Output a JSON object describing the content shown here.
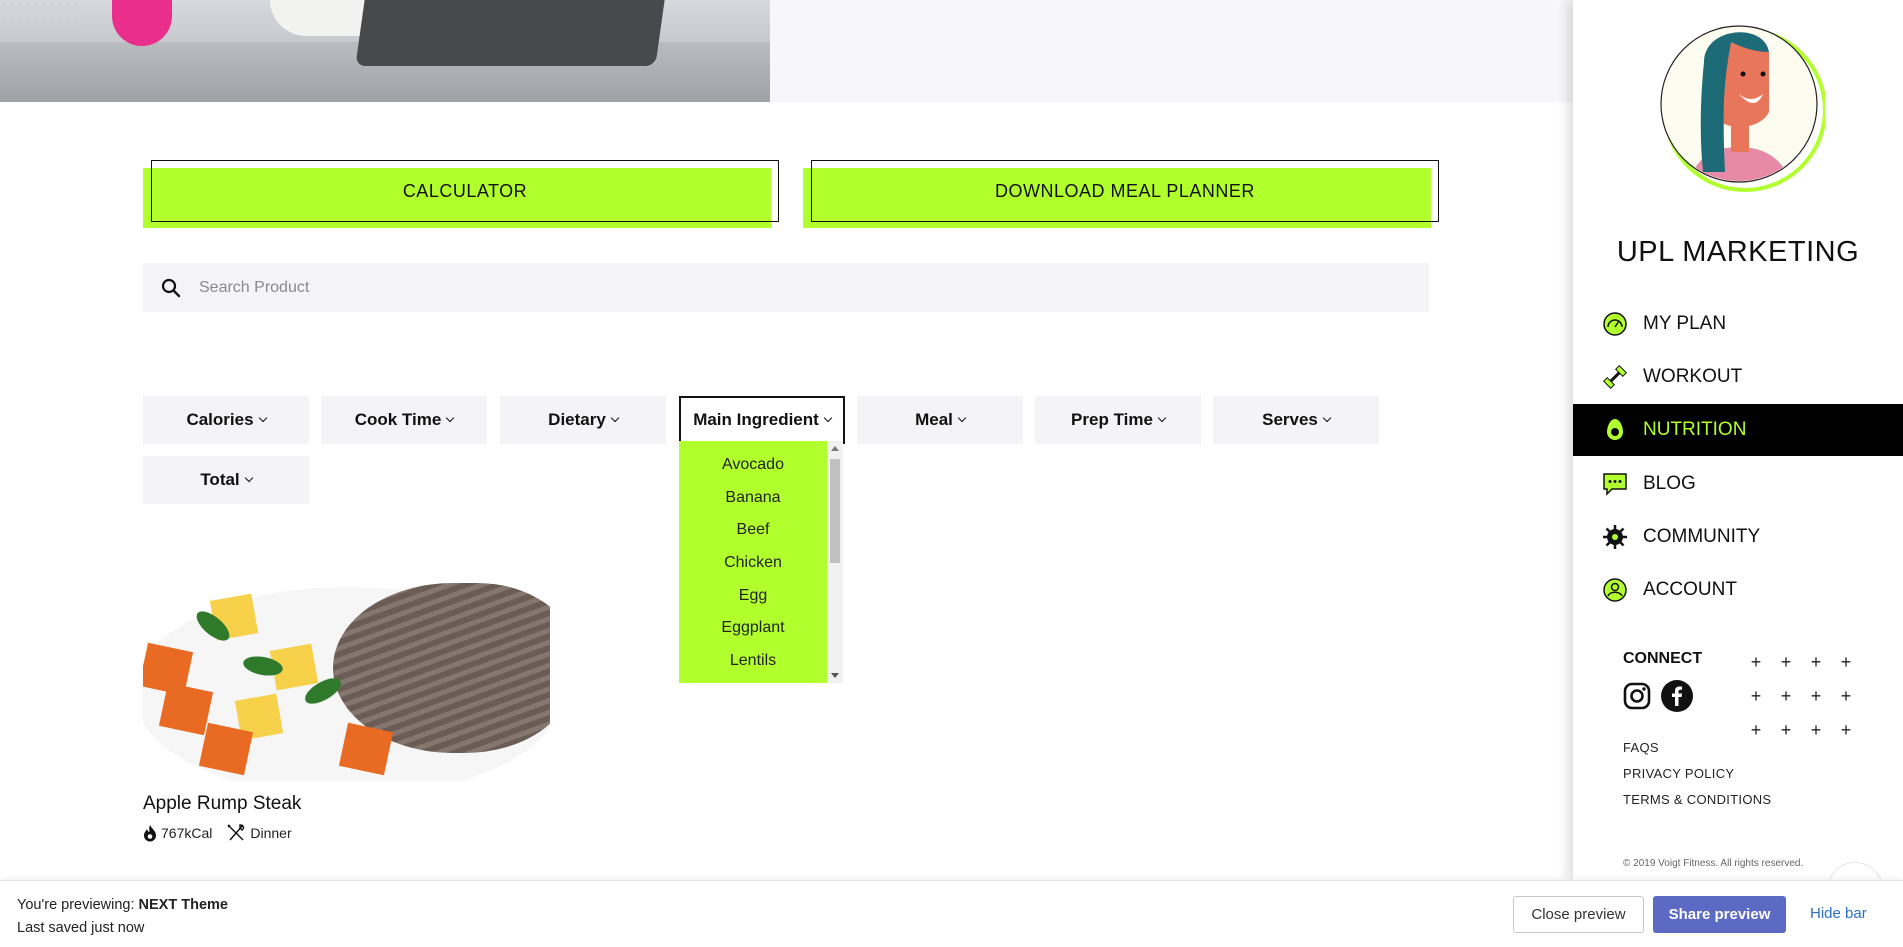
{
  "buttons": {
    "calculator": "CALCULATOR",
    "download": "DOWNLOAD MEAL PLANNER"
  },
  "search": {
    "placeholder": "Search Product",
    "icon": "search-icon"
  },
  "filters": [
    {
      "label": "Calories"
    },
    {
      "label": "Cook Time"
    },
    {
      "label": "Dietary"
    },
    {
      "label": "Main Ingredient"
    },
    {
      "label": "Meal"
    },
    {
      "label": "Prep Time"
    },
    {
      "label": "Serves"
    },
    {
      "label": "Total"
    }
  ],
  "dropdown": {
    "options": [
      "Avocado",
      "Banana",
      "Beef",
      "Chicken",
      "Egg",
      "Eggplant",
      "Lentils"
    ]
  },
  "recipe": {
    "title": "Apple Rump Steak",
    "calories": "767kCal",
    "meal": "Dinner"
  },
  "sidebar": {
    "brand": "UPL MARKETING",
    "nav": [
      {
        "label": "MY PLAN",
        "icon": "gauge-icon"
      },
      {
        "label": "WORKOUT",
        "icon": "dumbbell-icon"
      },
      {
        "label": "NUTRITION",
        "icon": "avocado-icon"
      },
      {
        "label": "BLOG",
        "icon": "chat-icon"
      },
      {
        "label": "COMMUNITY",
        "icon": "community-icon"
      },
      {
        "label": "ACCOUNT",
        "icon": "user-icon"
      }
    ],
    "connect": "CONNECT",
    "links": [
      "FAQS",
      "PRIVACY POLICY",
      "TERMS & CONDITIONS"
    ],
    "copyright": "© 2019 Voigt Fitness. All rights reserved.",
    "accent": "#b2ff2e"
  },
  "preview_bar": {
    "prefix": "You're previewing: ",
    "theme": "NEXT Theme",
    "saved": "Last saved just now",
    "close": "Close preview",
    "share": "Share preview",
    "hide": "Hide bar"
  }
}
